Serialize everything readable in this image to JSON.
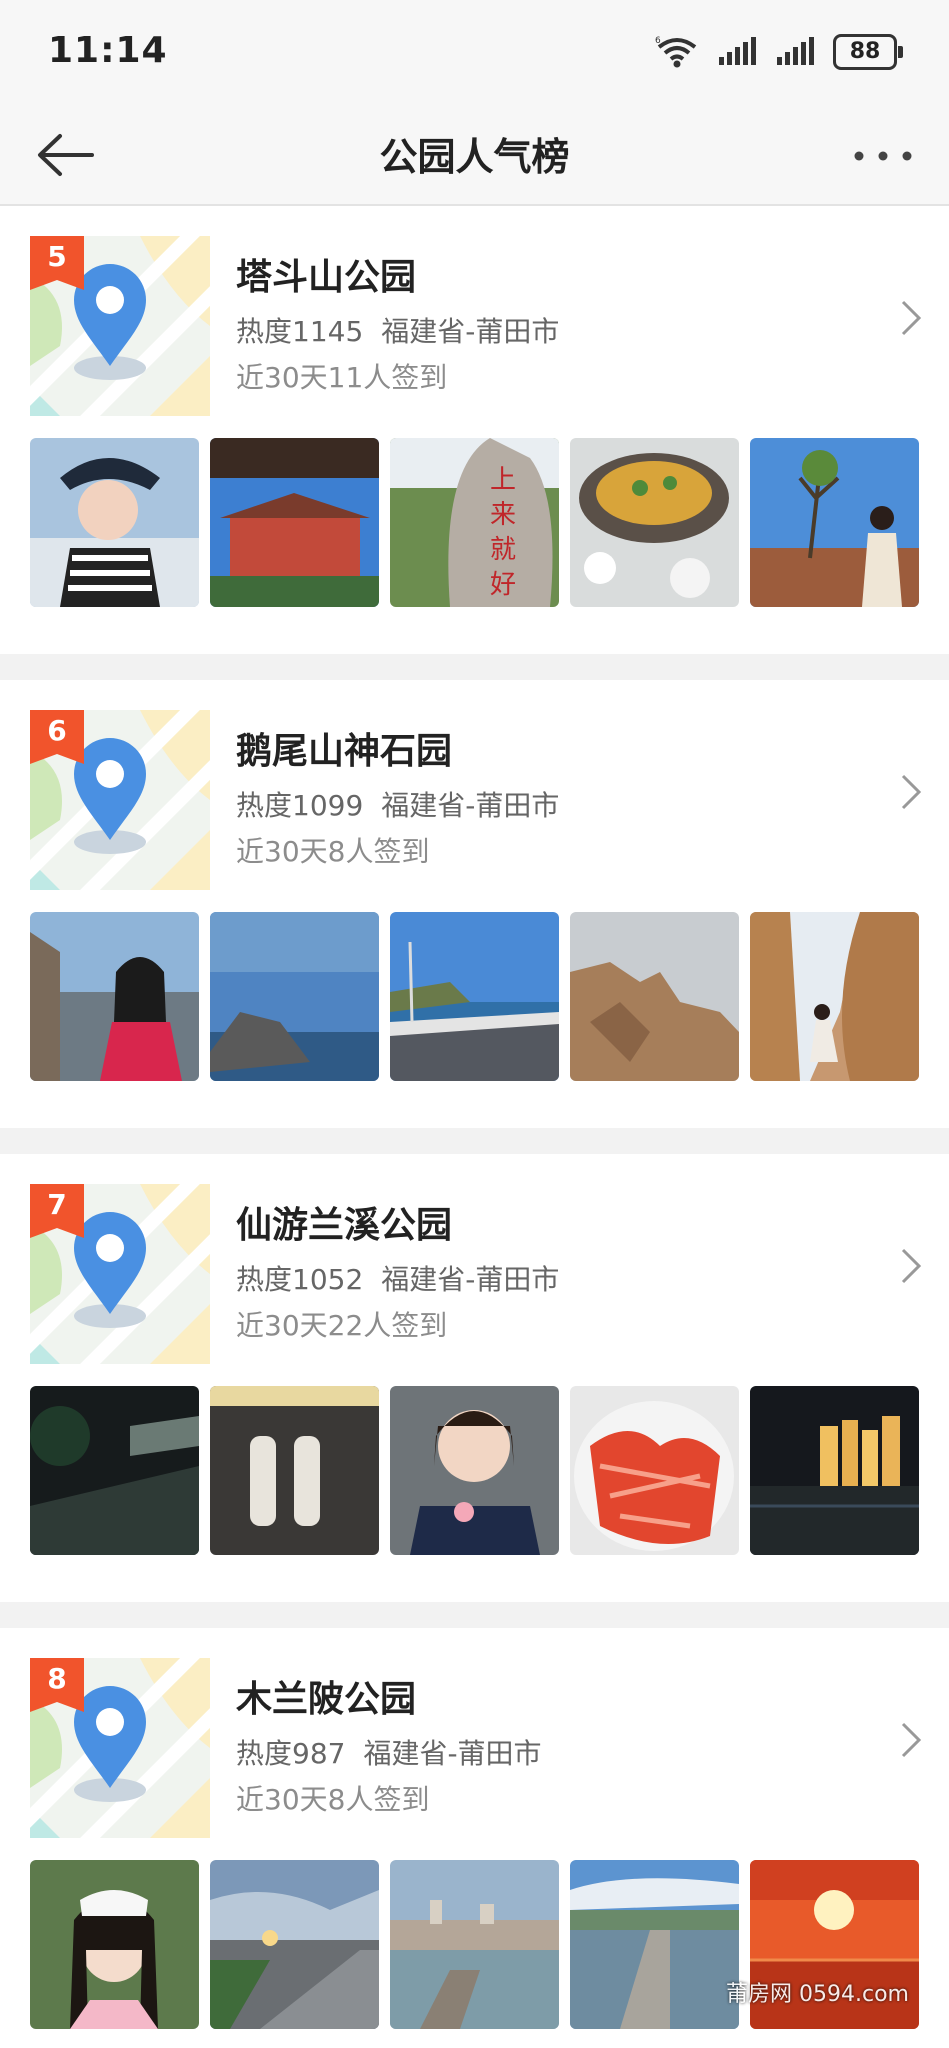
{
  "status_bar": {
    "time": "11:14",
    "battery": "88"
  },
  "nav": {
    "title": "公园人气榜"
  },
  "parks": [
    {
      "rank": "5",
      "name": "塔斗山公园",
      "heat": "热度1145",
      "region": "福建省-莆田市",
      "checkins": "近30天11人签到",
      "photos": [
        "woman-visor-portrait",
        "temple-building",
        "carved-stone-上来就好",
        "food-dish",
        "woman-by-tree"
      ]
    },
    {
      "rank": "6",
      "name": "鹅尾山神石园",
      "heat": "热度1099",
      "region": "福建省-莆田市",
      "checkins": "近30天8人签到",
      "photos": [
        "woman-sunglasses-sea",
        "rocky-coast-blue-sky",
        "seaside-road",
        "rock-formation",
        "woman-in-rock-arch"
      ]
    },
    {
      "rank": "7",
      "name": "仙游兰溪公园",
      "heat": "热度1052",
      "region": "福建省-莆田市",
      "checkins": "近30天22人签到",
      "photos": [
        "night-riverside-path",
        "pastry-rolls",
        "woman-heart-gesture",
        "crayfish-plate",
        "city-night-skyline"
      ]
    },
    {
      "rank": "8",
      "name": "木兰陂公园",
      "heat": "热度987",
      "region": "福建省-莆田市",
      "checkins": "近30天8人签到",
      "photos": [
        "woman-white-beret",
        "sunset-road",
        "river-city-view",
        "stone-weir",
        "red-sunset"
      ]
    }
  ],
  "watermark": "莆房网 0594.com",
  "colors": {
    "rank_badge": "#f1542c",
    "map_pin": "#4a90e2",
    "background": "#f2f2f2"
  }
}
